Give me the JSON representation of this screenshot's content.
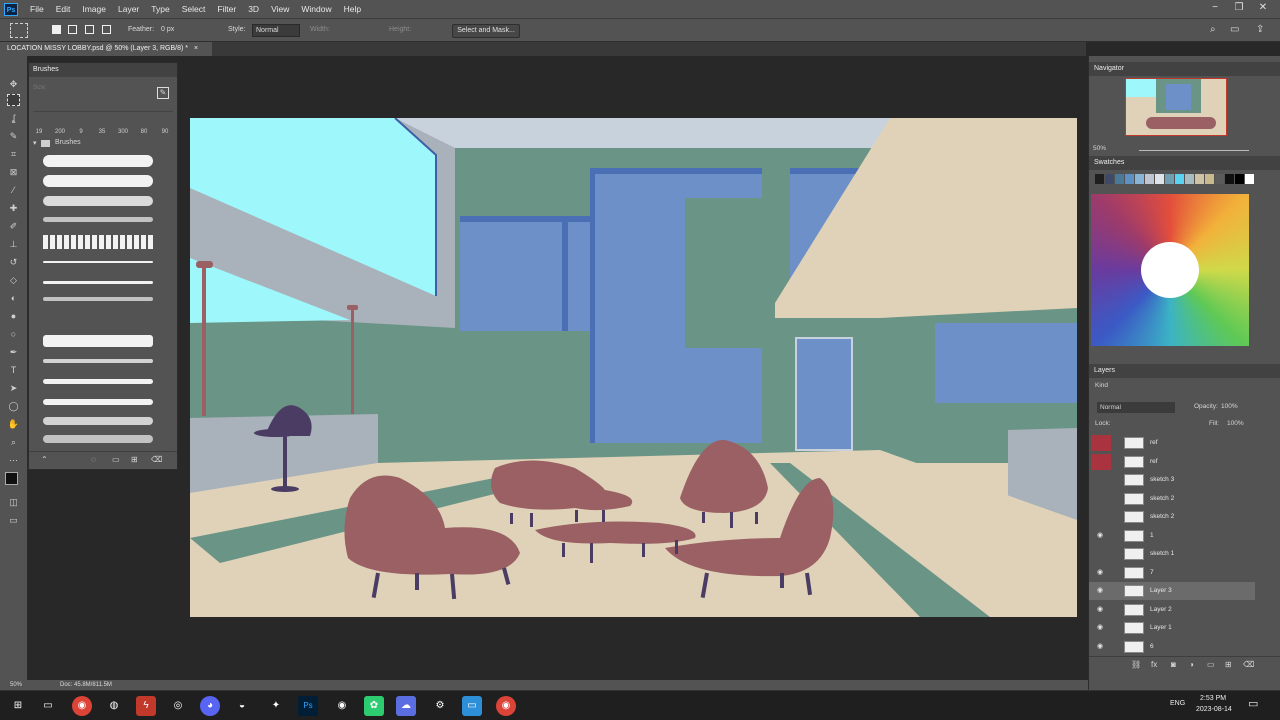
{
  "app": {
    "logo": "Ps",
    "menu": [
      "File",
      "Edit",
      "Image",
      "Layer",
      "Type",
      "Select",
      "Filter",
      "3D",
      "View",
      "Window",
      "Help"
    ],
    "window_controls": [
      "−",
      "❐",
      "✕"
    ]
  },
  "options": {
    "feather_label": "Feather:",
    "feather_value": "0 px",
    "style_label": "Style:",
    "style_value": "Normal",
    "width_label": "Width:",
    "height_label": "Height:",
    "select_mask": "Select and Mask..."
  },
  "document": {
    "tab_title": "LOCATION MISSY LOBBY.psd @ 50% (Layer 3, RGB/8) *",
    "close": "×"
  },
  "brushes_panel": {
    "title": "Brushes",
    "size_label": "Size:",
    "sizes": [
      "19",
      "200",
      "9",
      "35",
      "300",
      "80",
      "90"
    ],
    "folder": "Brushes"
  },
  "navigator": {
    "title": "Navigator",
    "zoom": "50%"
  },
  "swatches": {
    "title": "Swatches",
    "colors": [
      "#1f1f1f",
      "#3f4a68",
      "#4a7a9a",
      "#5d91c5",
      "#8ab4d6",
      "#bfc6d2",
      "#dfe3ea",
      "#6f9fb0",
      "#5ad2f0",
      "#a8bcc0",
      "#cfc3a6",
      "#c9b98f",
      "#5b5b5b",
      "#111111",
      "#000000",
      "#ffffff"
    ]
  },
  "layers": {
    "title": "Layers",
    "kind": "Kind",
    "blend": "Normal",
    "opacity_label": "Opacity:",
    "opacity": "100%",
    "lock_label": "Lock:",
    "fill_label": "Fill:",
    "fill": "100%",
    "rows": [
      {
        "name": "ref",
        "visible": false,
        "red": true
      },
      {
        "name": "ref",
        "visible": false,
        "red": true
      },
      {
        "name": "sketch 3",
        "visible": false,
        "red": false
      },
      {
        "name": "sketch 2",
        "visible": false,
        "red": false
      },
      {
        "name": "sketch 2",
        "visible": false,
        "red": false
      },
      {
        "name": "1",
        "visible": true,
        "red": false
      },
      {
        "name": "sketch 1",
        "visible": false,
        "red": false
      },
      {
        "name": "7",
        "visible": true,
        "red": false
      },
      {
        "name": "Layer 3",
        "visible": true,
        "red": false
      },
      {
        "name": "Layer 2",
        "visible": true,
        "red": false
      },
      {
        "name": "Layer 1",
        "visible": true,
        "red": false
      },
      {
        "name": "6",
        "visible": true,
        "red": false
      }
    ]
  },
  "status": {
    "zoom": "50%",
    "doc": "Doc: 45.8M/811.5M"
  },
  "taskbar": {
    "lang": "ENG",
    "time": "2:53 PM",
    "date": "2023-08-14"
  },
  "colors": {
    "sky": "#9ef8fb",
    "wall": "#6a9485",
    "window_blue": "#6d90c8",
    "floor": "#dfd2b8",
    "furniture": "#9a6063",
    "stool": "#4a3c63",
    "gray": "#a9b1bb"
  }
}
